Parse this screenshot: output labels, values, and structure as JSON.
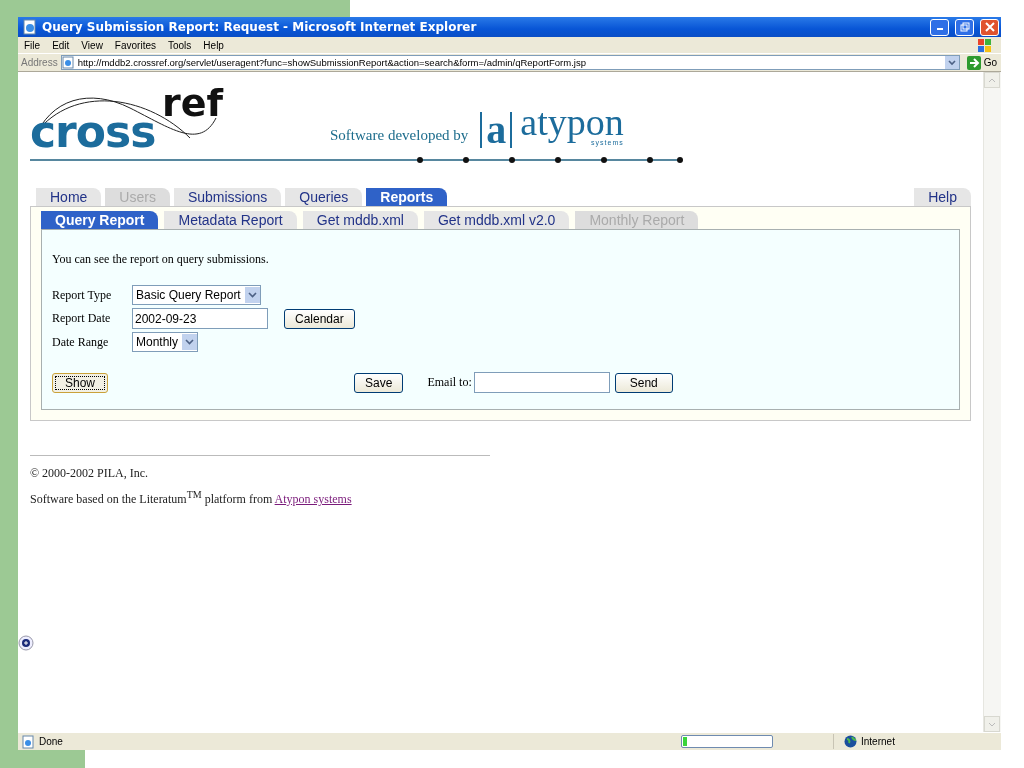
{
  "window": {
    "title": "Query Submission Report: Request - Microsoft Internet Explorer"
  },
  "menu": [
    "File",
    "Edit",
    "View",
    "Favorites",
    "Tools",
    "Help"
  ],
  "address_bar": {
    "label": "Address",
    "url": "http://mddb2.crossref.org/servlet/useragent?func=showSubmissionReport&action=search&form=/admin/qReportForm.jsp",
    "go": "Go"
  },
  "header": {
    "logo_left": "cross",
    "logo_right": "ref",
    "tagline": "Software developed by",
    "mark": "a",
    "brand": "atypon",
    "brand_sub": "systems"
  },
  "tabs": [
    {
      "label": "Home",
      "selected": false,
      "disabled": false
    },
    {
      "label": "Users",
      "selected": false,
      "disabled": true
    },
    {
      "label": "Submissions",
      "selected": false,
      "disabled": false
    },
    {
      "label": "Queries",
      "selected": false,
      "disabled": false
    },
    {
      "label": "Reports",
      "selected": true,
      "disabled": false
    }
  ],
  "help_tab": {
    "label": "Help"
  },
  "subtabs": [
    {
      "label": "Query Report",
      "selected": true,
      "disabled": false
    },
    {
      "label": "Metadata Report",
      "selected": false,
      "disabled": false
    },
    {
      "label": "Get mddb.xml",
      "selected": false,
      "disabled": false
    },
    {
      "label": "Get mddb.xml v2.0",
      "selected": false,
      "disabled": false
    },
    {
      "label": "Monthly Report",
      "selected": false,
      "disabled": true
    }
  ],
  "form": {
    "intro": "You can see the report on query submissions.",
    "fields": [
      {
        "kind": "select",
        "label": "Report Type",
        "value": "Basic Query Report"
      },
      {
        "kind": "text",
        "label": "Report Date",
        "value": "2002-09-23",
        "button": "Calendar"
      },
      {
        "kind": "select",
        "label": "Date Range",
        "value": "Monthly"
      }
    ],
    "show_button": "Show",
    "save_button": "Save",
    "email_label": "Email to:",
    "send_button": "Send"
  },
  "footer": {
    "copyright": "© 2000-2002 PILA, Inc.",
    "credit": "Software based on the Literatum$^{TM}$ platform from ",
    "link": "Atypon systems"
  },
  "status_bar": {
    "text": "Done",
    "progress": {
      "level": 0.04
    },
    "zone": "Internet"
  }
}
